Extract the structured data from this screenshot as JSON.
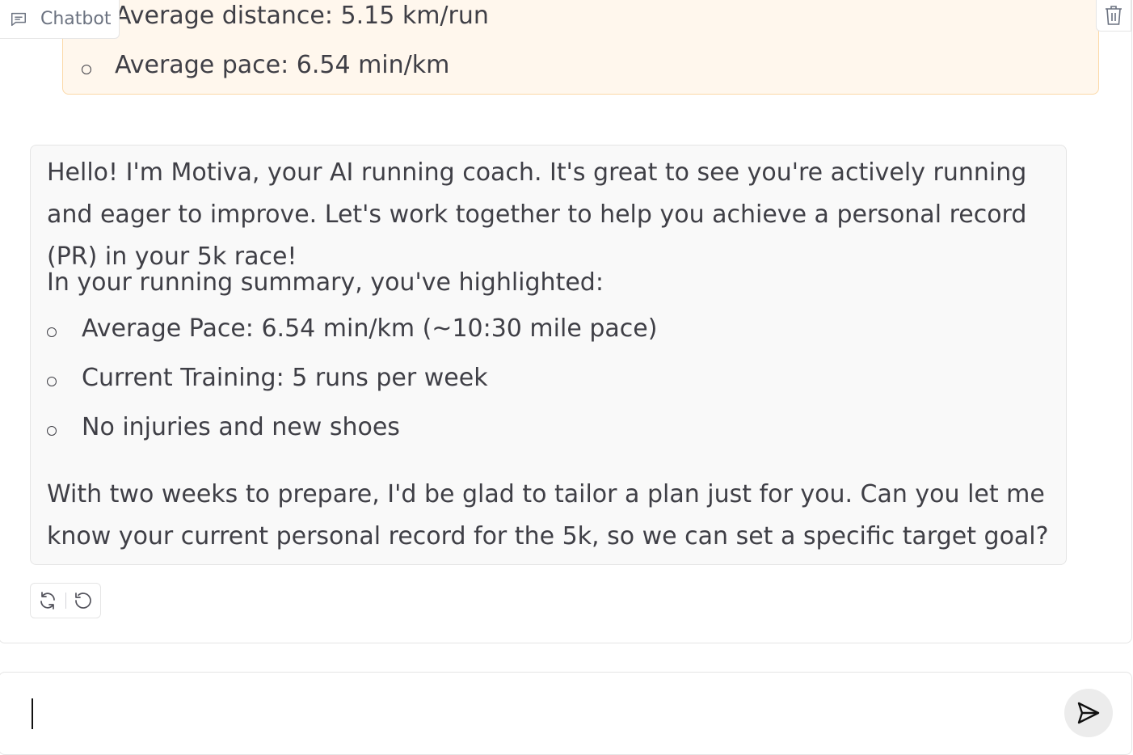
{
  "header": {
    "chatbot_label": "Chatbot",
    "chatbot_icon": "chat-bubble-icon",
    "clear_icon": "trash-icon"
  },
  "user_message": {
    "items": [
      "Average distance: 5.15 km/run",
      "Average pace: 6.54 min/km"
    ]
  },
  "bot_message": {
    "intro": "Hello! I'm Motiva, your AI running coach. It's great to see you're actively running and eager to improve. Let's work together to help you achieve a personal record (PR) in your 5k race!",
    "summary_heading": "In your running summary, you've highlighted:",
    "bullets": [
      "Average Pace: 6.54 min/km (~10:30 mile pace)",
      "Current Training: 5 runs per week",
      "No injuries and new shoes"
    ],
    "closing": "With two weeks to prepare, I'd be glad to tailor a plan just for you. Can you let me know your current personal record for the 5k, so we can set a specific target goal?"
  },
  "actions": {
    "retry_icon": "retry-icon",
    "undo_icon": "undo-icon"
  },
  "composer": {
    "value": "",
    "placeholder": "",
    "send_icon": "send-icon"
  },
  "colors": {
    "user_bubble_bg": "#fff7ed",
    "user_bubble_border": "#fcd9a8",
    "bot_bubble_bg": "#f9f9f9",
    "text": "#3f3f46"
  }
}
